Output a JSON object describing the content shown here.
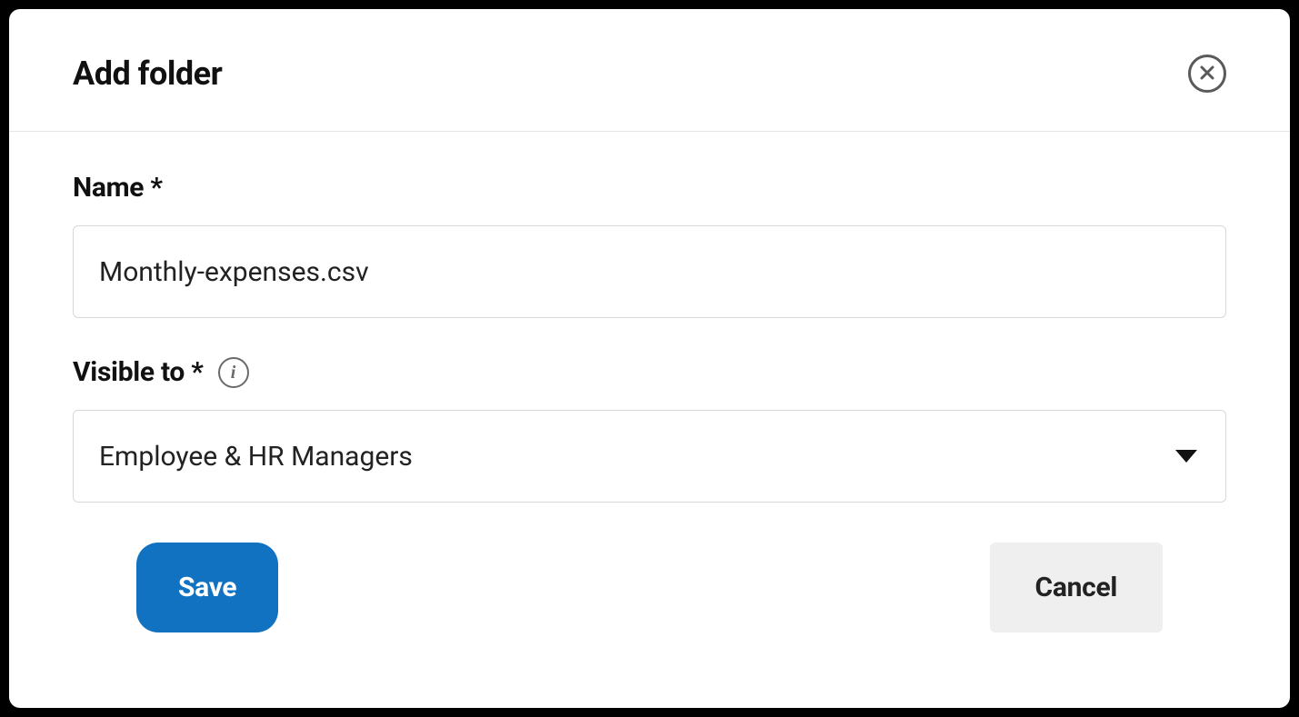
{
  "modal": {
    "title": "Add folder",
    "fields": {
      "name": {
        "label": "Name *",
        "value": "Monthly-expenses.csv"
      },
      "visible_to": {
        "label": "Visible to *",
        "selected": "Employee & HR Managers"
      }
    },
    "buttons": {
      "save": "Save",
      "cancel": "Cancel"
    }
  }
}
